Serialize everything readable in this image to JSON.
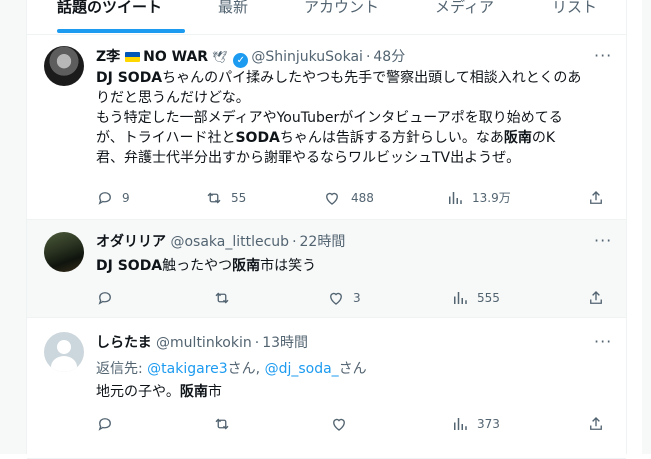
{
  "tabs": [
    "話題のツイート",
    "最新",
    "アカウント",
    "メディア",
    "リスト"
  ],
  "tweets": [
    {
      "name": "Z李",
      "no_war": "NO WAR",
      "handle": "@ShinjukuSokai",
      "sep": "·",
      "time": "48分",
      "line1_a": "DJ SODA",
      "line1_b": "ちゃんのパイ揉みしたやつも先手で警察出頭して相談入れとくのあ",
      "line2": "りだと思うんだけどな。",
      "line3": "もう特定した一部メディアやYouTuberがインタビューアポを取り始めてる",
      "line4_a": "が、トライハード社と",
      "line4_b": "SODA",
      "line4_c": "ちゃんは告訴する方針らしい。なあ",
      "line4_d": "阪南",
      "line4_e": "のK",
      "line5": "君、弁護士代半分出すから謝罪やるならワルビッシュTV出ようぜ。",
      "replies": "9",
      "retweets": "55",
      "likes": "488",
      "views": "13.9万"
    },
    {
      "name": "オダリリア",
      "handle": "@osaka_littlecub",
      "sep": "·",
      "time": "22時間",
      "text_a": "DJ SODA",
      "text_b": "触ったやつ",
      "text_c": "阪南",
      "text_d": "市は笑う",
      "replies": "",
      "retweets": "",
      "likes": "3",
      "views": "555"
    },
    {
      "name": "しらたま",
      "handle": "@multinkokin",
      "sep": "·",
      "time": "13時間",
      "reply_prefix": "返信先: ",
      "mention1": "@takigare3",
      "mention_sep": "さん, ",
      "mention2": "@dj_soda_",
      "mention_suffix": "さん",
      "text_a": "地元の子や。",
      "text_b": "阪南",
      "text_c": "市",
      "replies": "",
      "retweets": "",
      "likes": "",
      "views": "373"
    }
  ],
  "icons": {
    "reply": "reply-icon",
    "retweet": "retweet-icon",
    "like": "like-icon",
    "views": "views-icon",
    "share": "share-icon",
    "more": "more-icon",
    "verified": "verified-badge-icon",
    "flag": "ukraine-flag-icon",
    "dove": "dove-icon"
  },
  "colors": {
    "accent": "#1d9bf0",
    "text": "#0f1419",
    "muted": "#536471"
  }
}
